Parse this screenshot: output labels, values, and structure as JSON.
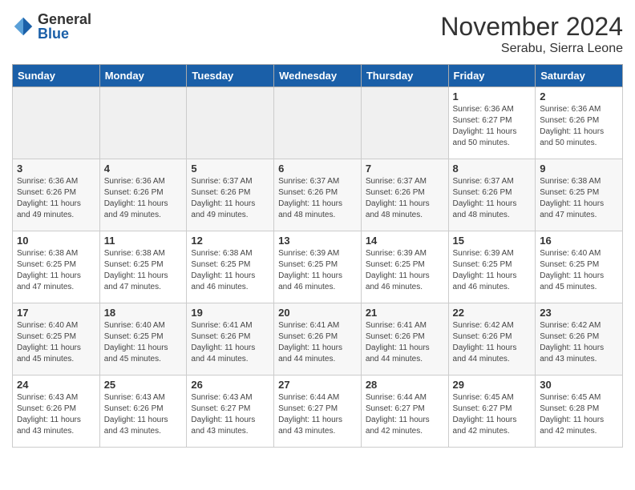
{
  "logo": {
    "general": "General",
    "blue": "Blue"
  },
  "title": {
    "month": "November 2024",
    "location": "Serabu, Sierra Leone"
  },
  "headers": [
    "Sunday",
    "Monday",
    "Tuesday",
    "Wednesday",
    "Thursday",
    "Friday",
    "Saturday"
  ],
  "weeks": [
    [
      {
        "day": "",
        "info": "",
        "empty": true
      },
      {
        "day": "",
        "info": "",
        "empty": true
      },
      {
        "day": "",
        "info": "",
        "empty": true
      },
      {
        "day": "",
        "info": "",
        "empty": true
      },
      {
        "day": "",
        "info": "",
        "empty": true
      },
      {
        "day": "1",
        "info": "Sunrise: 6:36 AM\nSunset: 6:27 PM\nDaylight: 11 hours\nand 50 minutes."
      },
      {
        "day": "2",
        "info": "Sunrise: 6:36 AM\nSunset: 6:26 PM\nDaylight: 11 hours\nand 50 minutes."
      }
    ],
    [
      {
        "day": "3",
        "info": "Sunrise: 6:36 AM\nSunset: 6:26 PM\nDaylight: 11 hours\nand 49 minutes."
      },
      {
        "day": "4",
        "info": "Sunrise: 6:36 AM\nSunset: 6:26 PM\nDaylight: 11 hours\nand 49 minutes."
      },
      {
        "day": "5",
        "info": "Sunrise: 6:37 AM\nSunset: 6:26 PM\nDaylight: 11 hours\nand 49 minutes."
      },
      {
        "day": "6",
        "info": "Sunrise: 6:37 AM\nSunset: 6:26 PM\nDaylight: 11 hours\nand 48 minutes."
      },
      {
        "day": "7",
        "info": "Sunrise: 6:37 AM\nSunset: 6:26 PM\nDaylight: 11 hours\nand 48 minutes."
      },
      {
        "day": "8",
        "info": "Sunrise: 6:37 AM\nSunset: 6:26 PM\nDaylight: 11 hours\nand 48 minutes."
      },
      {
        "day": "9",
        "info": "Sunrise: 6:38 AM\nSunset: 6:25 PM\nDaylight: 11 hours\nand 47 minutes."
      }
    ],
    [
      {
        "day": "10",
        "info": "Sunrise: 6:38 AM\nSunset: 6:25 PM\nDaylight: 11 hours\nand 47 minutes."
      },
      {
        "day": "11",
        "info": "Sunrise: 6:38 AM\nSunset: 6:25 PM\nDaylight: 11 hours\nand 47 minutes."
      },
      {
        "day": "12",
        "info": "Sunrise: 6:38 AM\nSunset: 6:25 PM\nDaylight: 11 hours\nand 46 minutes."
      },
      {
        "day": "13",
        "info": "Sunrise: 6:39 AM\nSunset: 6:25 PM\nDaylight: 11 hours\nand 46 minutes."
      },
      {
        "day": "14",
        "info": "Sunrise: 6:39 AM\nSunset: 6:25 PM\nDaylight: 11 hours\nand 46 minutes."
      },
      {
        "day": "15",
        "info": "Sunrise: 6:39 AM\nSunset: 6:25 PM\nDaylight: 11 hours\nand 46 minutes."
      },
      {
        "day": "16",
        "info": "Sunrise: 6:40 AM\nSunset: 6:25 PM\nDaylight: 11 hours\nand 45 minutes."
      }
    ],
    [
      {
        "day": "17",
        "info": "Sunrise: 6:40 AM\nSunset: 6:25 PM\nDaylight: 11 hours\nand 45 minutes."
      },
      {
        "day": "18",
        "info": "Sunrise: 6:40 AM\nSunset: 6:25 PM\nDaylight: 11 hours\nand 45 minutes."
      },
      {
        "day": "19",
        "info": "Sunrise: 6:41 AM\nSunset: 6:26 PM\nDaylight: 11 hours\nand 44 minutes."
      },
      {
        "day": "20",
        "info": "Sunrise: 6:41 AM\nSunset: 6:26 PM\nDaylight: 11 hours\nand 44 minutes."
      },
      {
        "day": "21",
        "info": "Sunrise: 6:41 AM\nSunset: 6:26 PM\nDaylight: 11 hours\nand 44 minutes."
      },
      {
        "day": "22",
        "info": "Sunrise: 6:42 AM\nSunset: 6:26 PM\nDaylight: 11 hours\nand 44 minutes."
      },
      {
        "day": "23",
        "info": "Sunrise: 6:42 AM\nSunset: 6:26 PM\nDaylight: 11 hours\nand 43 minutes."
      }
    ],
    [
      {
        "day": "24",
        "info": "Sunrise: 6:43 AM\nSunset: 6:26 PM\nDaylight: 11 hours\nand 43 minutes."
      },
      {
        "day": "25",
        "info": "Sunrise: 6:43 AM\nSunset: 6:26 PM\nDaylight: 11 hours\nand 43 minutes."
      },
      {
        "day": "26",
        "info": "Sunrise: 6:43 AM\nSunset: 6:27 PM\nDaylight: 11 hours\nand 43 minutes."
      },
      {
        "day": "27",
        "info": "Sunrise: 6:44 AM\nSunset: 6:27 PM\nDaylight: 11 hours\nand 43 minutes."
      },
      {
        "day": "28",
        "info": "Sunrise: 6:44 AM\nSunset: 6:27 PM\nDaylight: 11 hours\nand 42 minutes."
      },
      {
        "day": "29",
        "info": "Sunrise: 6:45 AM\nSunset: 6:27 PM\nDaylight: 11 hours\nand 42 minutes."
      },
      {
        "day": "30",
        "info": "Sunrise: 6:45 AM\nSunset: 6:28 PM\nDaylight: 11 hours\nand 42 minutes."
      }
    ]
  ]
}
